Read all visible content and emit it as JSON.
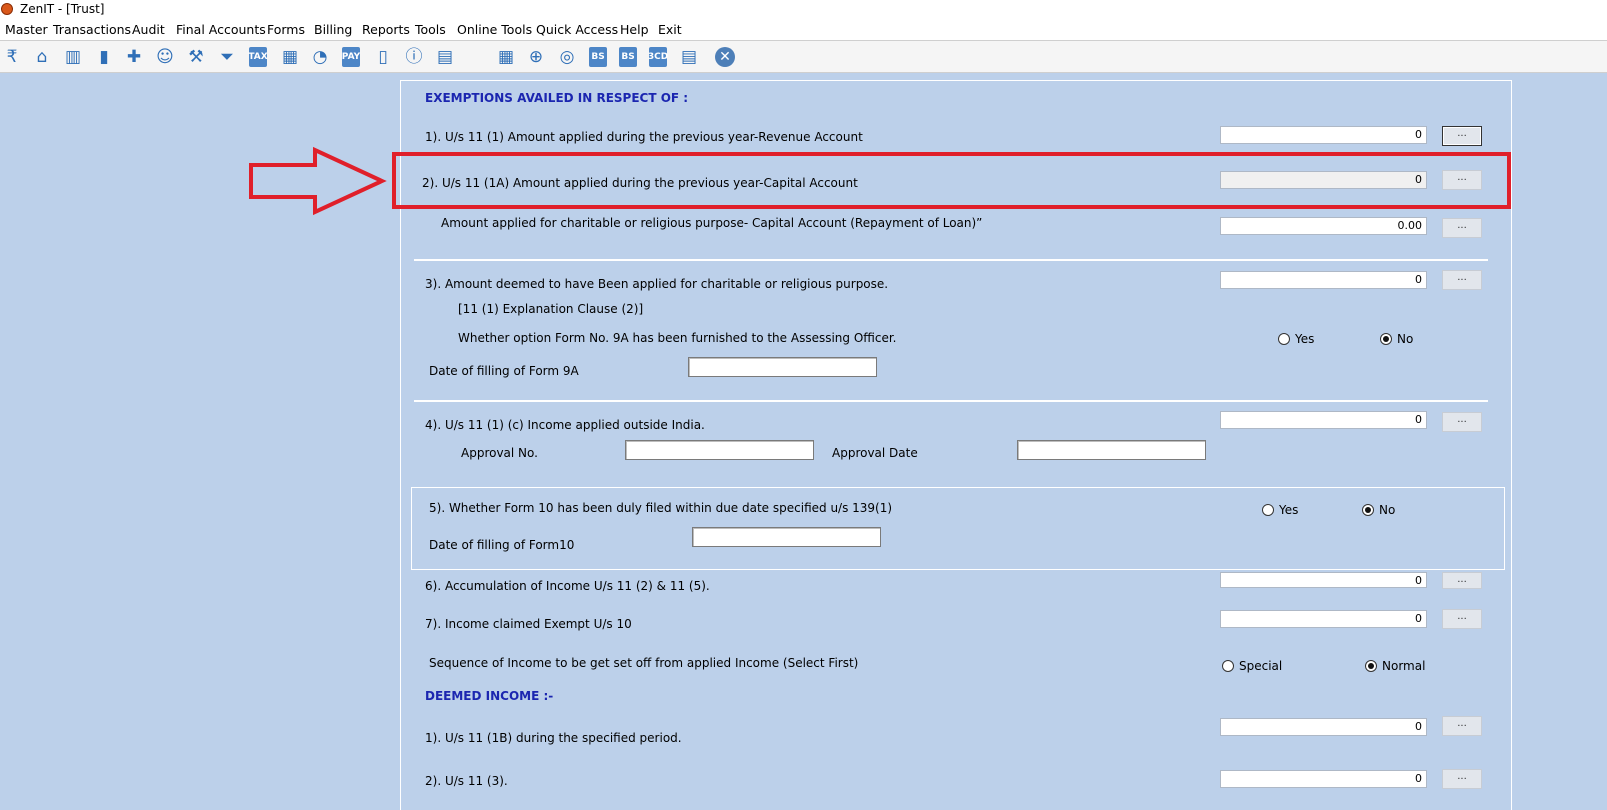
{
  "window": {
    "title": "ZenIT - [Trust]"
  },
  "menu": [
    "Master",
    "Transactions",
    "Audit",
    "Final Accounts",
    "Forms",
    "Billing",
    "Reports",
    "Tools",
    "Online Tools",
    "Quick Access",
    "Help",
    "Exit"
  ],
  "toolbar": {
    "icons": [
      "rupee-book",
      "home",
      "building",
      "bar-chart",
      "gift",
      "users",
      "hammer",
      "filter",
      "tax",
      "calculator",
      "pie-chart",
      "e-pay",
      "book",
      "info",
      "document",
      "calendar",
      "folder-add",
      "stamp",
      "bs",
      "bs-sch",
      "3cd",
      "report",
      "close"
    ],
    "tax_label": "TAX",
    "pay_label": "PAY",
    "bs_label": "BS",
    "bssch_label": "BS",
    "cd_label": "3CD"
  },
  "form": {
    "section1_header": "EXEMPTIONS AVAILED IN RESPECT OF :",
    "row1": {
      "label": "1). U/s 11 (1) Amount applied during the previous year-Revenue Account",
      "value": "0",
      "btn": "..."
    },
    "row2": {
      "label": "2). U/s 11 (1A) Amount applied during the previous year-Capital Account",
      "value": "0",
      "btn": "..."
    },
    "row2b": {
      "label": "Amount applied for charitable or religious purpose- Capital Account (Repayment of Loan)”",
      "value": "0.00",
      "btn": "..."
    },
    "row3": {
      "label": "3).  Amount deemed to have Been applied for charitable or religious purpose.",
      "sublabel": "[11 (1) Explanation Clause (2)]",
      "question": "Whether option Form No. 9A has been furnished to the Assessing Officer.",
      "value": "0",
      "btn": "...",
      "yes": "Yes",
      "no": "No",
      "selected": "No",
      "date_label": "Date of filling of Form 9A",
      "date_value": ""
    },
    "row4": {
      "label": "4).  U/s 11 (1) (c) Income applied outside India.",
      "value": "0",
      "btn": "...",
      "approval_no_label": "Approval No.",
      "approval_no": "",
      "approval_date_label": "Approval Date",
      "approval_date": ""
    },
    "row5": {
      "label": "5). Whether Form 10 has been duly filed within due date specified u/s 139(1)",
      "yes": "Yes",
      "no": "No",
      "selected": "No",
      "date_label": "Date of filling of Form10",
      "date_value": ""
    },
    "row6": {
      "label": "6).  Accumulation of Income U/s 11 (2) & 11 (5).",
      "value": "0",
      "btn": "..."
    },
    "row7": {
      "label": "7).  Income claimed Exempt U/s 10",
      "value": "0",
      "btn": "..."
    },
    "sequence": {
      "label": "Sequence of Income to be get set off from applied Income (Select First)",
      "special": "Special",
      "normal": "Normal",
      "selected": "Normal"
    },
    "section2_header": "DEEMED INCOME :-",
    "deemed1": {
      "label": "1).  U/s 11 (1B) during the specified period.",
      "value": "0",
      "btn": "..."
    },
    "deemed2": {
      "label": "2).  U/s 11 (3).",
      "value": "0",
      "btn": "..."
    }
  },
  "annotation": {
    "color": "#e01f2a"
  }
}
